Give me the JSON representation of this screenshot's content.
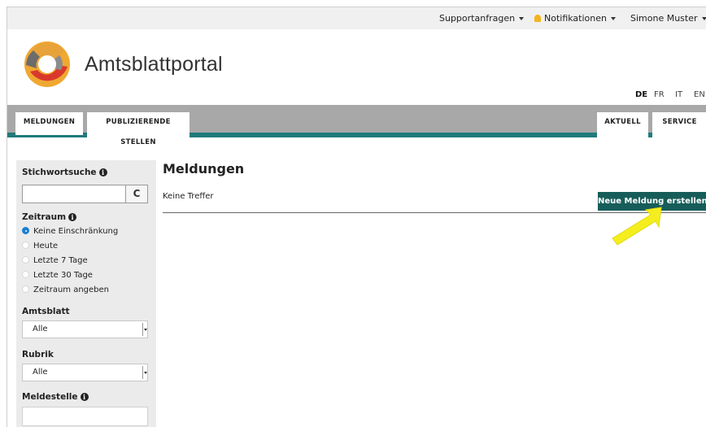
{
  "topbar": {
    "support": "Supportanfragen",
    "notifications": "Notifikationen",
    "user": "Simone Muster"
  },
  "brand": {
    "name": "Amtsblattportal"
  },
  "languages": [
    "DE",
    "FR",
    "IT",
    "EN"
  ],
  "nav": {
    "left_tabs": [
      "MELDUNGEN",
      "PUBLIZIERENDE STELLEN"
    ],
    "right_tabs": [
      "AKTUELL",
      "SERVICE"
    ]
  },
  "sidebar": {
    "keyword_label": "Stichwortsuche",
    "timeframe_label": "Zeitraum",
    "timeframe_options": [
      "Keine Einschränkung",
      "Heute",
      "Letzte 7 Tage",
      "Letzte 30 Tage",
      "Zeitraum angeben"
    ],
    "timeframe_selected": 0,
    "gazette_label": "Amtsblatt",
    "gazette_value": "Alle",
    "rubric_label": "Rubrik",
    "rubric_value": "Alle",
    "office_label": "Meldestelle"
  },
  "main": {
    "title": "Meldungen",
    "empty_text": "Keine Treffer",
    "new_button": "Neue Meldung erstellen"
  },
  "colors": {
    "teal": "#1f7b7a",
    "button": "#165d59",
    "arrow": "#f5ee1f"
  }
}
